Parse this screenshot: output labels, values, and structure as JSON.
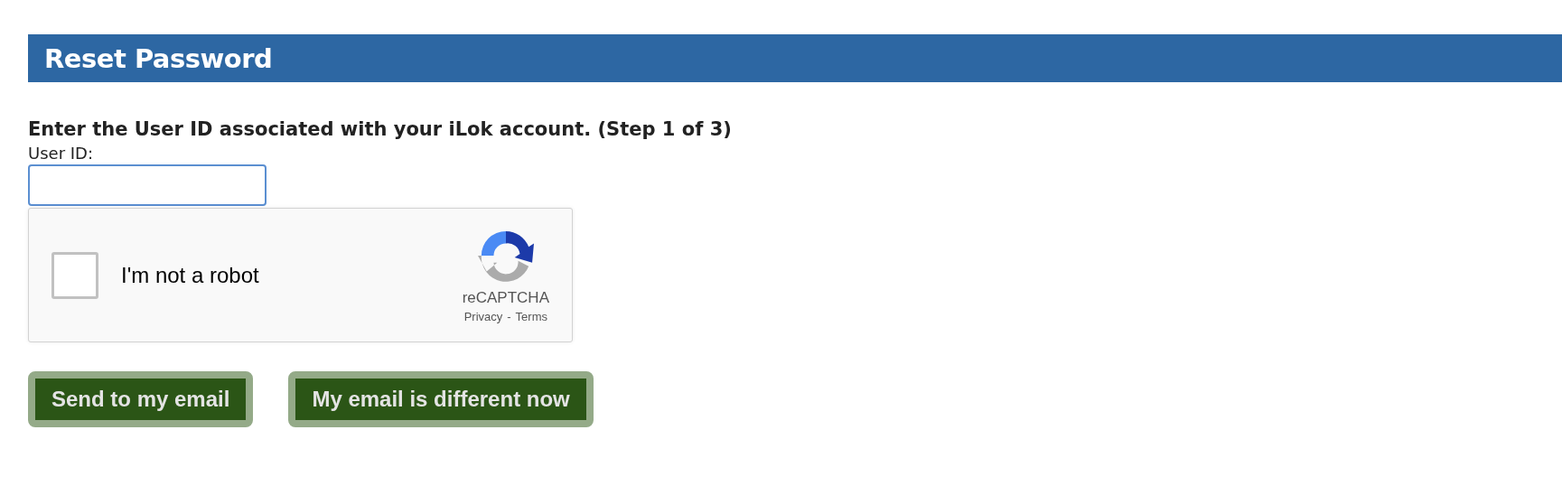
{
  "header": {
    "title": "Reset Password"
  },
  "form": {
    "instruction": "Enter the User ID associated with your iLok account. (Step 1 of 3)",
    "user_id_label": "User ID:",
    "user_id_focused": true
  },
  "captcha": {
    "label": "I'm not a robot",
    "checked": false,
    "brand": "reCAPTCHA",
    "privacy": "Privacy",
    "separator": "-",
    "terms": "Terms"
  },
  "buttons": [
    {
      "label": "Send to my email"
    },
    {
      "label": "My email is different now"
    }
  ]
}
